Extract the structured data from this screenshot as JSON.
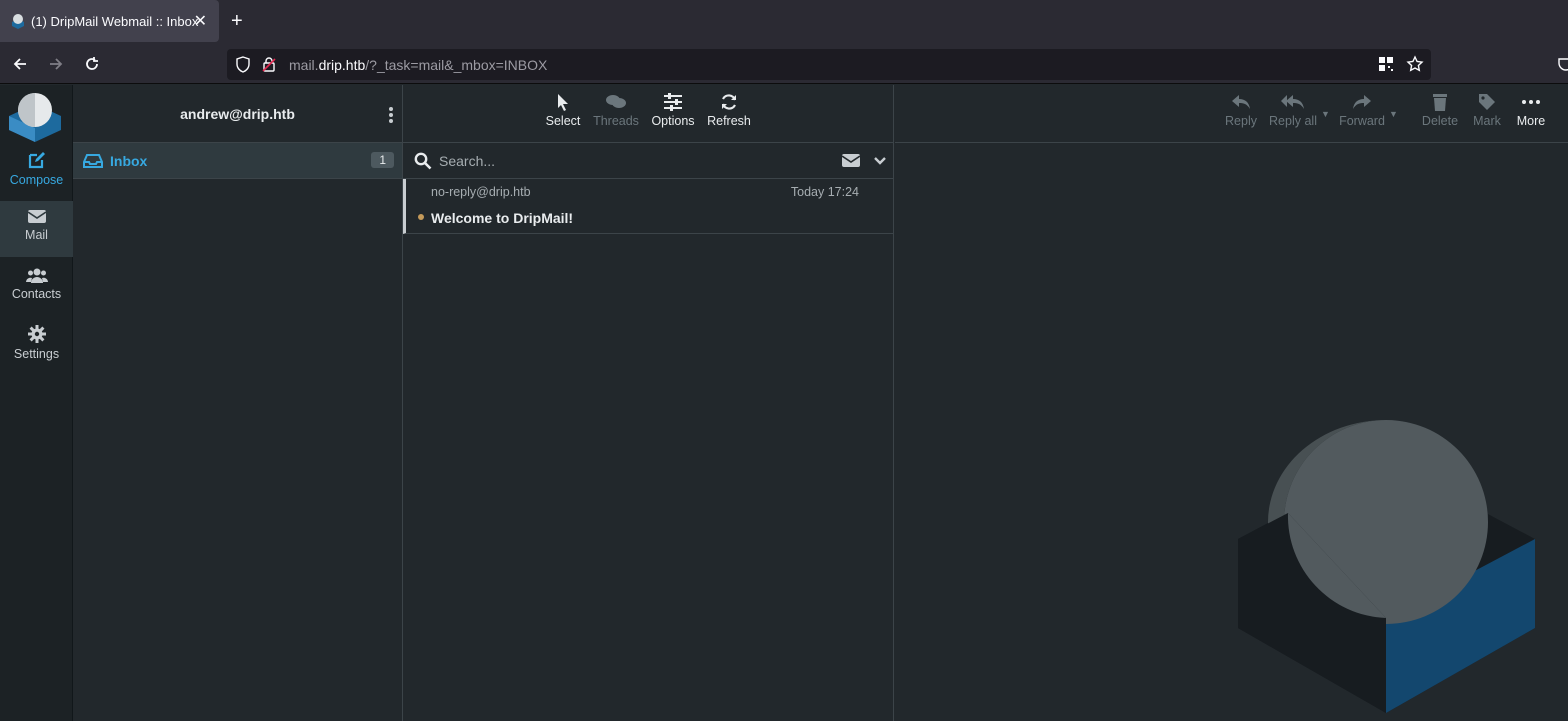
{
  "browser": {
    "tab_title": "(1) DripMail Webmail :: Inbox",
    "tab_close": "✕",
    "new_tab": "+",
    "url_prefix": "mail.",
    "url_host": "drip.htb",
    "url_path": "/?_task=mail&_mbox=INBOX"
  },
  "sidebar": {
    "items": [
      {
        "label": "Compose",
        "icon": "compose-icon"
      },
      {
        "label": "Mail",
        "icon": "envelope-icon"
      },
      {
        "label": "Contacts",
        "icon": "users-icon"
      },
      {
        "label": "Settings",
        "icon": "gear-icon"
      }
    ]
  },
  "folders": {
    "account": "andrew@drip.htb",
    "items": [
      {
        "label": "Inbox",
        "unread": "1",
        "icon": "inbox-icon"
      }
    ]
  },
  "list_toolbar": {
    "select": "Select",
    "threads": "Threads",
    "options": "Options",
    "refresh": "Refresh"
  },
  "search": {
    "placeholder": "Search..."
  },
  "messages": [
    {
      "from": "no-reply@drip.htb",
      "date": "Today 17:24",
      "subject": "Welcome to DripMail!",
      "unread": true
    }
  ],
  "preview_toolbar": {
    "reply": "Reply",
    "reply_all": "Reply all",
    "forward": "Forward",
    "delete": "Delete",
    "mark": "Mark",
    "more": "More"
  },
  "colors": {
    "accent": "#37a9e1",
    "background": "#22282c",
    "sidebar": "#1c2225"
  }
}
